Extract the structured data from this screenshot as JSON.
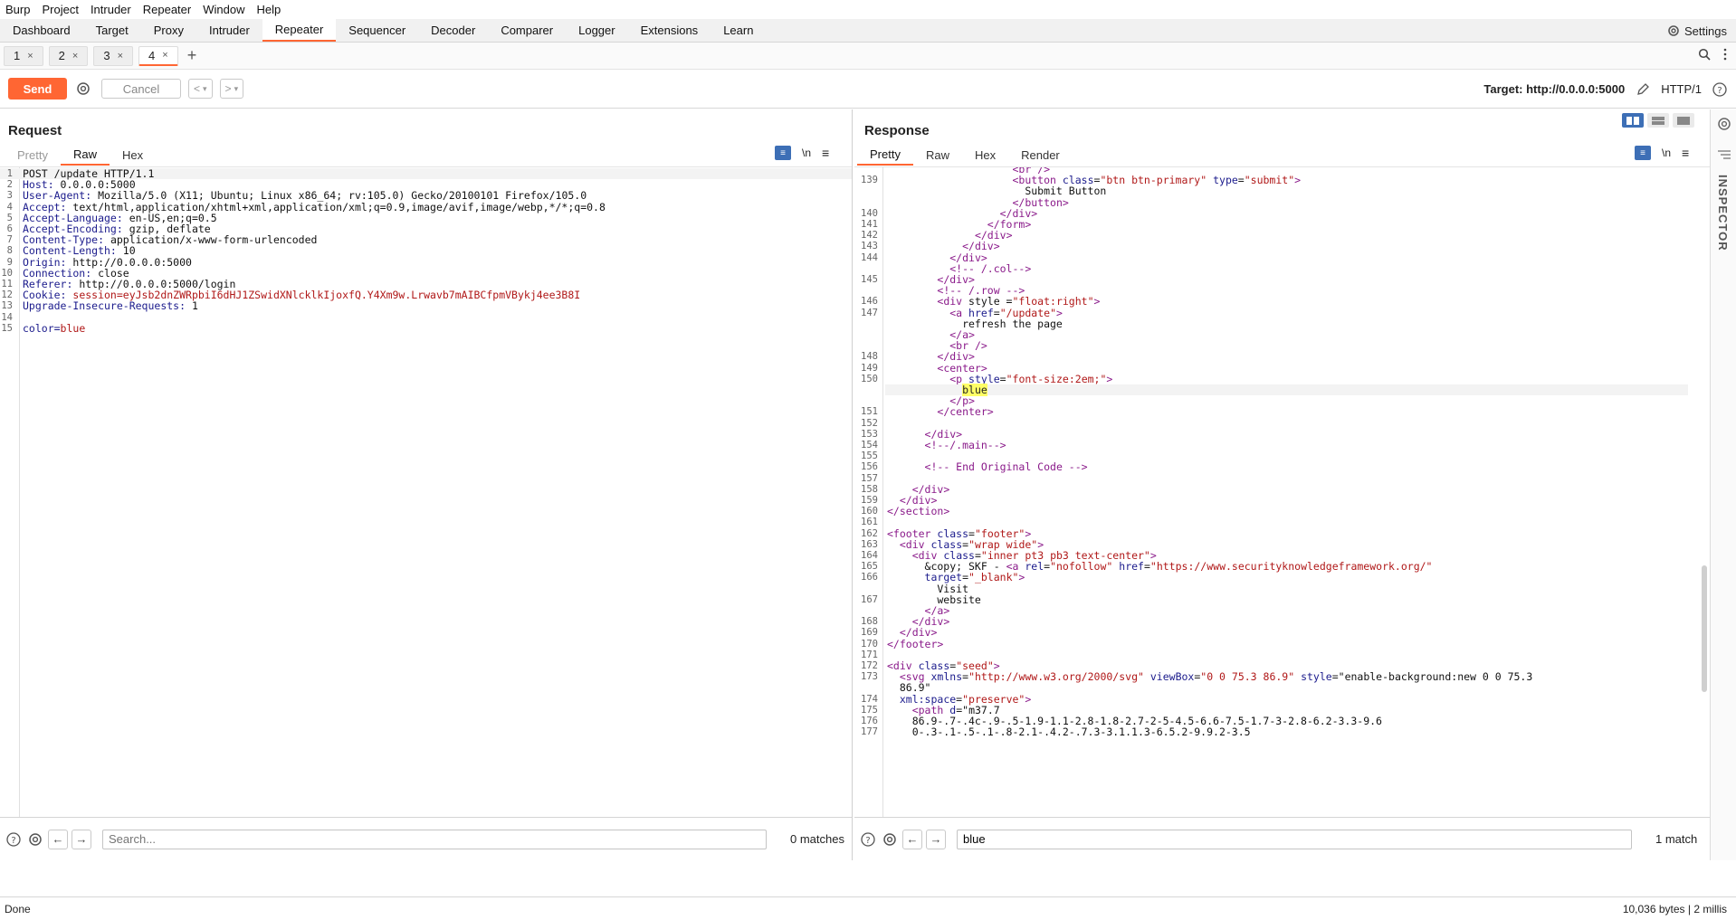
{
  "menubar": [
    "Burp",
    "Project",
    "Intruder",
    "Repeater",
    "Window",
    "Help"
  ],
  "tool_tabs": [
    "Dashboard",
    "Target",
    "Proxy",
    "Intruder",
    "Repeater",
    "Sequencer",
    "Decoder",
    "Comparer",
    "Logger",
    "Extensions",
    "Learn"
  ],
  "active_tool_tab": "Repeater",
  "settings_label": "Settings",
  "repeater_tabs": [
    "1",
    "2",
    "3",
    "4"
  ],
  "active_repeater_tab": "4",
  "toolbar": {
    "send_label": "Send",
    "cancel_label": "Cancel"
  },
  "target": {
    "label": "Target: http://0.0.0.0:5000",
    "protocol": "HTTP/1"
  },
  "request": {
    "title": "Request",
    "tabs": [
      "Pretty",
      "Raw",
      "Hex"
    ],
    "active_tab": "Raw",
    "newline_label": "\\n",
    "lines": [
      {
        "n": "1",
        "k": "",
        "v": "POST /update HTTP/1.1"
      },
      {
        "n": "2",
        "k": "Host:",
        "v": " 0.0.0.0:5000"
      },
      {
        "n": "3",
        "k": "User-Agent:",
        "v": " Mozilla/5.0 (X11; Ubuntu; Linux x86_64; rv:105.0) Gecko/20100101 Firefox/105.0"
      },
      {
        "n": "4",
        "k": "Accept:",
        "v": " text/html,application/xhtml+xml,application/xml;q=0.9,image/avif,image/webp,*/*;q=0.8"
      },
      {
        "n": "5",
        "k": "Accept-Language:",
        "v": " en-US,en;q=0.5"
      },
      {
        "n": "6",
        "k": "Accept-Encoding:",
        "v": " gzip, deflate"
      },
      {
        "n": "7",
        "k": "Content-Type:",
        "v": " application/x-www-form-urlencoded"
      },
      {
        "n": "8",
        "k": "Content-Length:",
        "v": " 10"
      },
      {
        "n": "9",
        "k": "Origin:",
        "v": " http://0.0.0.0:5000"
      },
      {
        "n": "10",
        "k": "Connection:",
        "v": " close"
      },
      {
        "n": "11",
        "k": "Referer:",
        "v": " http://0.0.0.0:5000/login"
      },
      {
        "n": "12",
        "k": "Cookie:",
        "v": " session=eyJsb2dnZWRpbiI6dHJ1ZSwidXNlcklkIjoxfQ.Y4Xm9w.Lrwavb7mAIBCfpmVBykj4ee3B8I"
      },
      {
        "n": "13",
        "k": "Upgrade-Insecure-Requests:",
        "v": " 1"
      },
      {
        "n": "14",
        "k": "",
        "v": ""
      },
      {
        "n": "15",
        "k": "color=",
        "v": "blue"
      }
    ],
    "search": {
      "placeholder": "Search...",
      "value": "",
      "matches": "0 matches"
    }
  },
  "response": {
    "title": "Response",
    "tabs": [
      "Pretty",
      "Raw",
      "Hex",
      "Render"
    ],
    "active_tab": "Pretty",
    "newline_label": "\\n",
    "lines": [
      {
        "n": "",
        "t": "                    <br />"
      },
      {
        "n": "139",
        "t": "                    <button class=\"btn btn-primary\" type=\"submit\">"
      },
      {
        "n": "",
        "t": "                      Submit Button"
      },
      {
        "n": "",
        "t": "                    </button>"
      },
      {
        "n": "140",
        "t": "                  </div>"
      },
      {
        "n": "141",
        "t": "                </form>"
      },
      {
        "n": "142",
        "t": "              </div>"
      },
      {
        "n": "143",
        "t": "            </div>"
      },
      {
        "n": "144",
        "t": "          </div>"
      },
      {
        "n": "",
        "t": "          <!-- /.col-->"
      },
      {
        "n": "145",
        "t": "        </div>"
      },
      {
        "n": "",
        "t": "        <!-- /.row -->"
      },
      {
        "n": "146",
        "t": "        <div style =\"float:right\">"
      },
      {
        "n": "147",
        "t": "          <a href=\"/update\">"
      },
      {
        "n": "",
        "t": "            refresh the page"
      },
      {
        "n": "",
        "t": "          </a>"
      },
      {
        "n": "",
        "t": "          <br />"
      },
      {
        "n": "148",
        "t": "        </div>"
      },
      {
        "n": "149",
        "t": "        <center>"
      },
      {
        "n": "150",
        "t": "          <p style=\"font-size:2em;\">"
      },
      {
        "n": "",
        "t": "            blue",
        "hl": true
      },
      {
        "n": "",
        "t": "          </p>"
      },
      {
        "n": "151",
        "t": "        </center>"
      },
      {
        "n": "152",
        "t": ""
      },
      {
        "n": "153",
        "t": "      </div>"
      },
      {
        "n": "154",
        "t": "      <!--/.main-->"
      },
      {
        "n": "155",
        "t": ""
      },
      {
        "n": "156",
        "t": "      <!-- End Original Code -->"
      },
      {
        "n": "157",
        "t": ""
      },
      {
        "n": "158",
        "t": "    </div>"
      },
      {
        "n": "159",
        "t": "  </div>"
      },
      {
        "n": "160",
        "t": "</section>"
      },
      {
        "n": "161",
        "t": ""
      },
      {
        "n": "162",
        "t": "<footer class=\"footer\">"
      },
      {
        "n": "163",
        "t": "  <div class=\"wrap wide\">"
      },
      {
        "n": "164",
        "t": "    <div class=\"inner pt3 pb3 text-center\">"
      },
      {
        "n": "165",
        "t": "      &copy; SKF - <a rel=\"nofollow\" href=\"https://www.securityknowledgeframework.org/\""
      },
      {
        "n": "166",
        "t": "      target=\"_blank\">"
      },
      {
        "n": "",
        "t": "        Visit"
      },
      {
        "n": "167",
        "t": "        website"
      },
      {
        "n": "",
        "t": "      </a>"
      },
      {
        "n": "168",
        "t": "    </div>"
      },
      {
        "n": "169",
        "t": "  </div>"
      },
      {
        "n": "170",
        "t": "</footer>"
      },
      {
        "n": "171",
        "t": ""
      },
      {
        "n": "172",
        "t": "<div class=\"seed\">"
      },
      {
        "n": "173",
        "t": "  <svg xmlns=\"http://www.w3.org/2000/svg\" viewBox=\"0 0 75.3 86.9\" style=\"enable-background:new 0 0 75.3"
      },
      {
        "n": "",
        "t": "  86.9\""
      },
      {
        "n": "174",
        "t": "  xml:space=\"preserve\">"
      },
      {
        "n": "175",
        "t": "    <path d=\"m37.7"
      },
      {
        "n": "176",
        "t": "    86.9-.7-.4c-.9-.5-1.9-1.1-2.8-1.8-2.7-2-5-4.5-6.6-7.5-1.7-3-2.8-6.2-3.3-9.6"
      },
      {
        "n": "177",
        "t": "    0-.3-.1-.5-.1-.8-2.1-.4.2-.7.3-3.1.1.3-6.5.2-9.9.2-3.5"
      }
    ],
    "search": {
      "placeholder": "Search...",
      "value": "blue",
      "matches": "1 match"
    }
  },
  "inspector_label": "INSPECTOR",
  "status": {
    "left": "Done",
    "right": "10,036 bytes | 2 millis"
  },
  "colors": {
    "accent": "#ff6633",
    "blue": "#3d6fb6"
  }
}
